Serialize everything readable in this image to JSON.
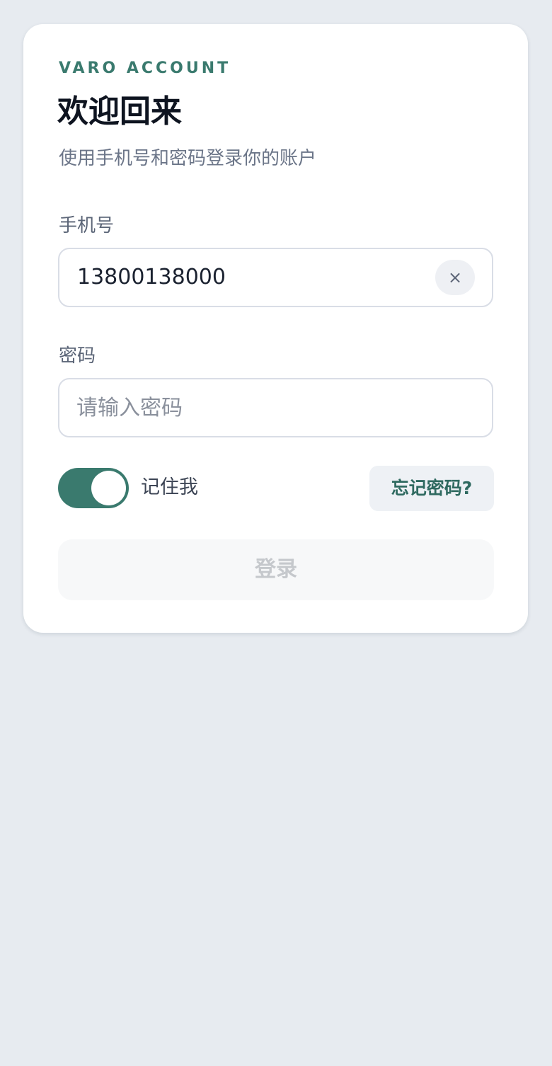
{
  "header": {
    "brand": "VARO ACCOUNT",
    "title": "欢迎回来",
    "subtitle": "使用手机号和密码登录你的账户"
  },
  "phone": {
    "label": "手机号",
    "value": "13800138000",
    "clear_label": "×"
  },
  "password": {
    "label": "密码",
    "placeholder": "请输入密码",
    "value": ""
  },
  "remember": {
    "label": "记住我",
    "on": true
  },
  "forgot_label": "忘记密码?",
  "login_label": "登录",
  "colors": {
    "accent": "#3a7a6e",
    "background": "#e7ebf0",
    "disabled_button": "#f7f8f9"
  }
}
